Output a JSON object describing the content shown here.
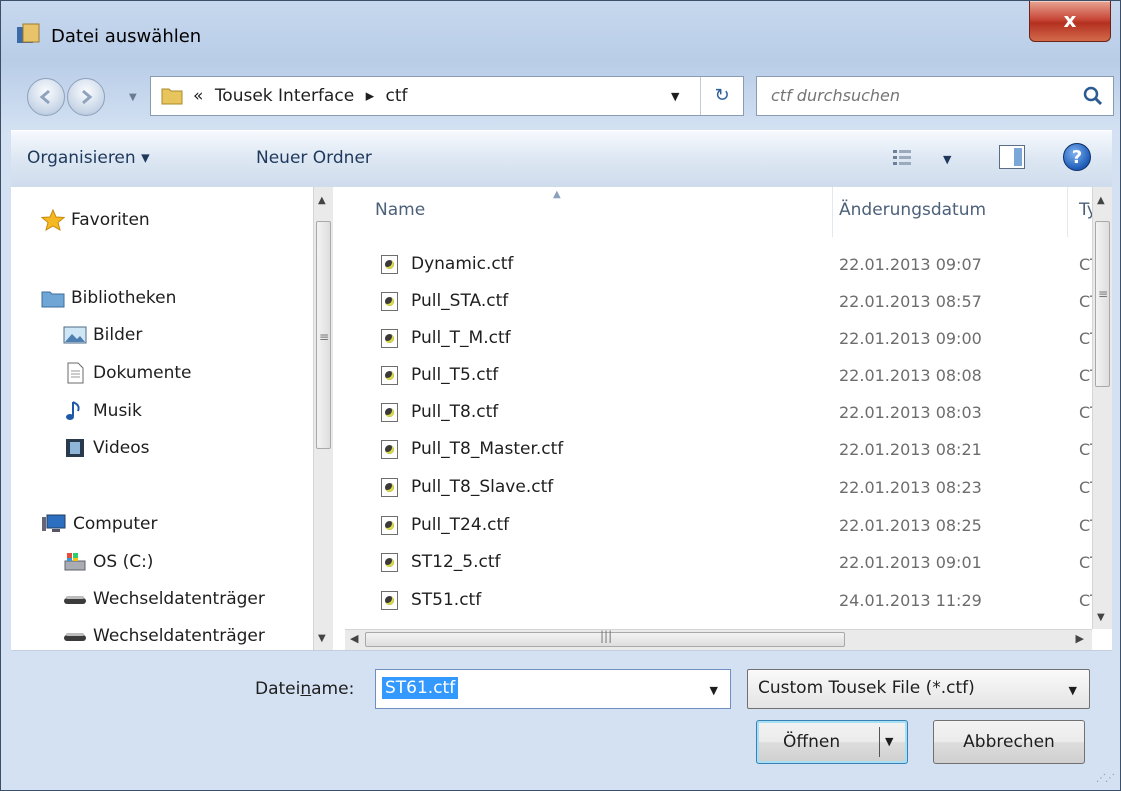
{
  "window": {
    "title": "Datei auswählen",
    "close": "x"
  },
  "address": {
    "prefix": "«",
    "crumbs": [
      "Tousek Interface",
      "▸",
      "ctf"
    ],
    "refresh_icon": "refresh-icon"
  },
  "search": {
    "placeholder": "ctf durchsuchen"
  },
  "toolbar": {
    "organize": "Organisieren ▾",
    "new_folder": "Neuer Ordner",
    "view_icon": "views-icon",
    "help": "?"
  },
  "nav": {
    "favorites": "Favoriten",
    "libraries": "Bibliotheken",
    "pictures": "Bilder",
    "documents": "Dokumente",
    "music": "Musik",
    "videos": "Videos",
    "computer": "Computer",
    "drive_c": "OS (C:)",
    "removable1": "Wechseldatenträger",
    "removable2": "Wechseldatenträger"
  },
  "columns": {
    "name": "Name",
    "date": "Änderungsdatum",
    "type": "Ty|"
  },
  "files": [
    {
      "name": "Dynamic.ctf",
      "date": "22.01.2013 09:07",
      "type": "CT"
    },
    {
      "name": "Pull_STA.ctf",
      "date": "22.01.2013 08:57",
      "type": "CT"
    },
    {
      "name": "Pull_T_M.ctf",
      "date": "22.01.2013 09:00",
      "type": "CT"
    },
    {
      "name": "Pull_T5.ctf",
      "date": "22.01.2013 08:08",
      "type": "CT"
    },
    {
      "name": "Pull_T8.ctf",
      "date": "22.01.2013 08:03",
      "type": "CT"
    },
    {
      "name": "Pull_T8_Master.ctf",
      "date": "22.01.2013 08:21",
      "type": "CT"
    },
    {
      "name": "Pull_T8_Slave.ctf",
      "date": "22.01.2013 08:23",
      "type": "CT"
    },
    {
      "name": "Pull_T24.ctf",
      "date": "22.01.2013 08:25",
      "type": "CT"
    },
    {
      "name": "ST12_5.ctf",
      "date": "22.01.2013 09:01",
      "type": "CT"
    },
    {
      "name": "ST51.ctf",
      "date": "24.01.2013 11:29",
      "type": "CT"
    }
  ],
  "footer": {
    "filename_label_pre": "Datei",
    "filename_label_u": "n",
    "filename_label_post": "ame:",
    "filename_value": "ST61.ctf",
    "filter_value": "Custom Tousek File (*.ctf)",
    "open_label": "Öffnen",
    "cancel_label": "Abbrechen"
  }
}
